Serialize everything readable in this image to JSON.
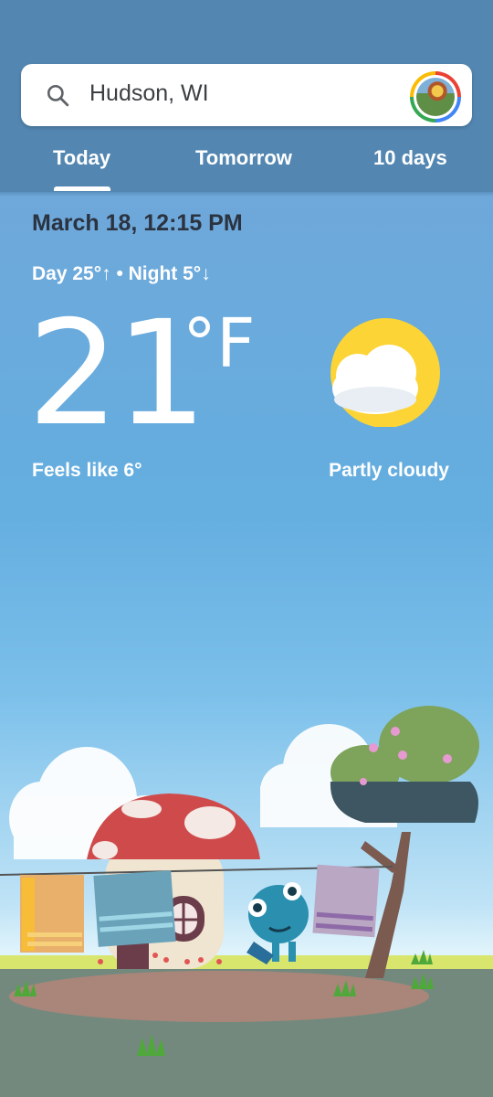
{
  "search": {
    "city": "Hudson, WI",
    "icon": "search-icon"
  },
  "tabs": [
    {
      "label": "Today",
      "active": true
    },
    {
      "label": "Tomorrow",
      "active": false
    },
    {
      "label": "10 days",
      "active": false
    }
  ],
  "weather": {
    "datetime": "March 18, 12:15 PM",
    "day_night": "Day 25°↑ • Night 5°↓",
    "temperature": "21",
    "unit": "°F",
    "feels_like": "Feels like 6°",
    "condition": "Partly cloudy",
    "condition_icon": "partly-cloudy-icon"
  },
  "colors": {
    "header_bg": "#5387b2",
    "sun": "#fcd435",
    "accent_text": "#2b3340"
  }
}
